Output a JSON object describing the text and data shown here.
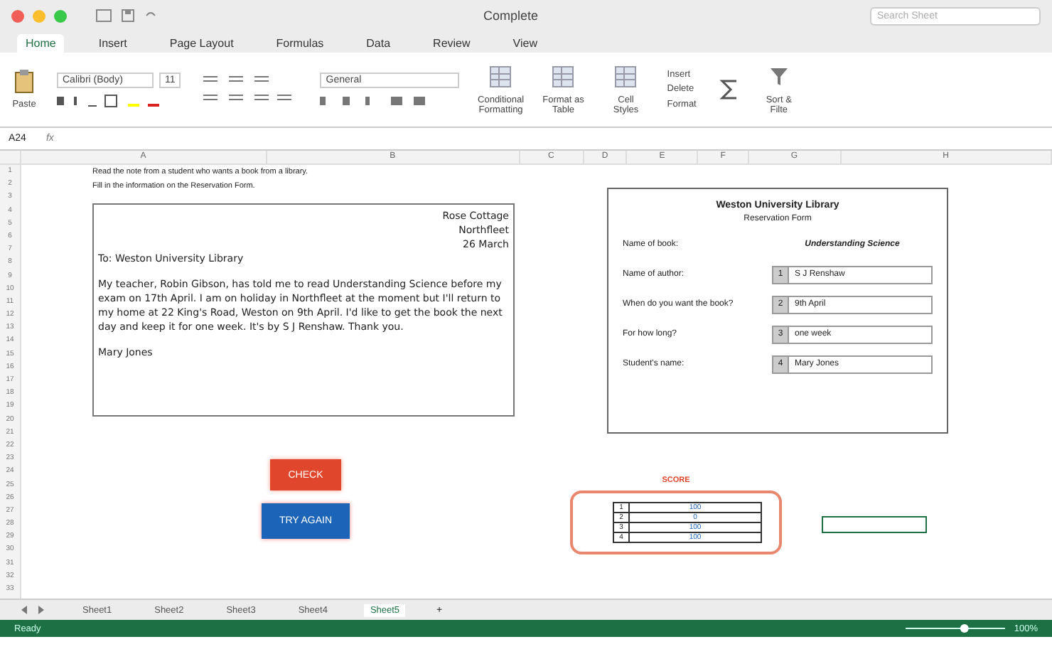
{
  "window": {
    "title": "Complete"
  },
  "search": {
    "placeholder": "Search Sheet"
  },
  "ribbon_tabs": [
    {
      "label": "Home",
      "selected": true
    },
    {
      "label": "Insert",
      "selected": false
    },
    {
      "label": "Page Layout",
      "selected": false
    },
    {
      "label": "Formulas",
      "selected": false
    },
    {
      "label": "Data",
      "selected": false
    },
    {
      "label": "Review",
      "selected": false
    },
    {
      "label": "View",
      "selected": false
    }
  ],
  "ribbon": {
    "paste": "Paste",
    "font": "Calibri (Body)",
    "size": "11",
    "number_format": "General",
    "styles": [
      "Conditional Formatting",
      "Format as Table",
      "Cell Styles"
    ],
    "cells": [
      "Insert",
      "Delete",
      "Format"
    ],
    "sort": "Sort & Filte"
  },
  "formula_bar": {
    "cell": "A24",
    "fx": "fx"
  },
  "columns": [
    "A",
    "B",
    "C",
    "D",
    "E",
    "F",
    "G",
    "H"
  ],
  "rows": [
    "1",
    "2",
    "3",
    "4",
    "5",
    "6",
    "7",
    "8",
    "9",
    "10",
    "11",
    "12",
    "13",
    "14",
    "15",
    "16",
    "17",
    "18",
    "19",
    "20",
    "21",
    "22",
    "23",
    "24",
    "25",
    "26",
    "27",
    "28",
    "29",
    "30",
    "31",
    "32",
    "33"
  ],
  "instructions": [
    "Read the note from a student who wants a book from a library.",
    "Fill in the information on the Reservation Form."
  ],
  "letter": {
    "address": [
      "Rose Cottage",
      "Northfleet",
      "26 March"
    ],
    "greeting": "To: Weston University Library",
    "body": "My teacher, Robin Gibson, has told me to read Understanding Science before my exam on 17th April. I am on holiday in Northfleet at the moment but I'll return to my home at 22 King's Road, Weston on 9th April. I'd like to get the book the next day and keep it for one week. It's by S J Renshaw. Thank you.",
    "signature": "Mary Jones"
  },
  "form": {
    "title": "Weston University Library",
    "subtitle": "Reservation Form",
    "book_label": "Name of book:",
    "book_value": "Understanding Science",
    "questions": [
      {
        "number": "1",
        "label": "Name of author:",
        "answer": "S J Renshaw"
      },
      {
        "number": "2",
        "label": "When do you want the book?",
        "answer": "9th April"
      },
      {
        "number": "3",
        "label": "For how long?",
        "answer": "one week"
      },
      {
        "number": "4",
        "label": "Student's name:",
        "answer": "Mary Jones"
      }
    ]
  },
  "buttons": [
    {
      "label": "CHECK",
      "kind": "check"
    },
    {
      "label": "TRY AGAIN",
      "kind": "retry"
    }
  ],
  "score": {
    "title": "SCORE",
    "rows": [
      {
        "number": "1",
        "value": "100"
      },
      {
        "number": "2",
        "value": "0"
      },
      {
        "number": "3",
        "value": "100"
      },
      {
        "number": "4",
        "value": "100"
      }
    ]
  },
  "sheet_tabs": [
    {
      "label": "Sheet1",
      "selected": false
    },
    {
      "label": "Sheet2",
      "selected": false
    },
    {
      "label": "Sheet3",
      "selected": false
    },
    {
      "label": "Sheet4",
      "selected": false
    },
    {
      "label": "Sheet5",
      "selected": true
    }
  ],
  "add_sheet": "+",
  "status_bar": {
    "text": "Ready",
    "zoom": "100%",
    "zoom_slider": {
      "level": 0.6
    }
  }
}
